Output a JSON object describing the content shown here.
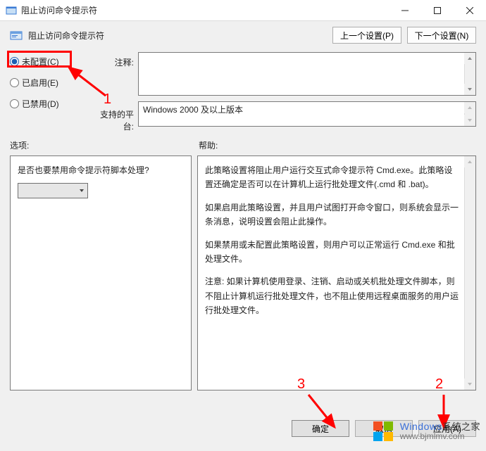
{
  "window": {
    "title": "阻止访问命令提示符"
  },
  "header": {
    "title": "阻止访问命令提示符",
    "prev_setting": "上一个设置(P)",
    "next_setting": "下一个设置(N)"
  },
  "config": {
    "radio_not_configured": "未配置(C)",
    "radio_enabled": "已启用(E)",
    "radio_disabled": "已禁用(D)",
    "notes_label": "注释:",
    "notes_value": "",
    "platform_label": "支持的平台:",
    "platform_value": "Windows 2000 及以上版本"
  },
  "lower": {
    "options_label": "选项:",
    "help_label": "帮助:",
    "options_question": "是否也要禁用命令提示符脚本处理?",
    "options_selected": "",
    "help_p1": "此策略设置将阻止用户运行交互式命令提示符 Cmd.exe。此策略设置还确定是否可以在计算机上运行批处理文件(.cmd 和 .bat)。",
    "help_p2": "如果启用此策略设置，并且用户试图打开命令窗口，则系统会显示一条消息，说明设置会阻止此操作。",
    "help_p3": "如果禁用或未配置此策略设置，则用户可以正常运行 Cmd.exe 和批处理文件。",
    "help_p4": "注意: 如果计算机使用登录、注销、启动或关机批处理文件脚本，则不阻止计算机运行批处理文件，也不阻止使用远程桌面服务的用户运行批处理文件。"
  },
  "footer": {
    "ok": "确定",
    "cancel": "取消",
    "apply": "应用(A)"
  },
  "annotations": {
    "num1": "1",
    "num2": "2",
    "num3": "3"
  },
  "watermark": {
    "brand_en": "Windows",
    "brand_cn": "系统之家",
    "url": "www.bjmlmv.com"
  }
}
